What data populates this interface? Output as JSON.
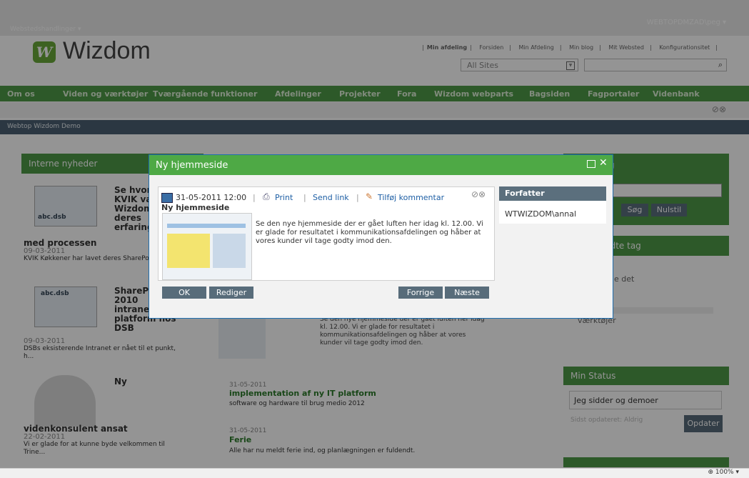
{
  "site_menu": "Webstedshandlinger",
  "user": "WEBTOPDMZAD\\peg",
  "logo": "Wizdom",
  "top_links": [
    "Min afdeling",
    "Forsiden",
    "Min Afdeling",
    "Min blog",
    "Mit Websted",
    "Konfigurationsitet"
  ],
  "scope_select": "All Sites",
  "nav": [
    "Om os",
    "Viden og værktøjer",
    "Tværgående funktioner",
    "Afdelinger",
    "Projekter",
    "Fora",
    "Wizdom webparts",
    "Bagsiden",
    "Fagportaler",
    "Videnbank"
  ],
  "breadcrumb": "Webtop Wizdom Demo",
  "news_panel": {
    "title": "Interne nyheder",
    "items": [
      {
        "thumb": "abc.dsb",
        "title_lines": [
          "Se hvor",
          "KVIK va",
          "Wizdom",
          "deres",
          "erfaring"
        ],
        "title_tail": "med processen",
        "date": "09-03-2011",
        "summary": "KVIK Køkkener har lavet deres SharePoint-intra..."
      },
      {
        "thumb": "abc.dsb",
        "title_lines": [
          "ShareP",
          "2010",
          "intrane",
          "platform hos",
          "DSB"
        ],
        "date": "09-03-2011",
        "summary": "DSBs eksisterende Intranet er nået til et punkt, h..."
      },
      {
        "title_lines": [
          "Ny"
        ],
        "title_tail": "videnkonsulent ansat",
        "date": "22-02-2011",
        "summary": "Vi er glade for at kunne byde velkommen til Trine..."
      }
    ]
  },
  "center_list": [
    {
      "summary_lines": [
        "Se den nye hjemmeside der er gået luften her idag",
        "kl. 12.00. Vi er glade for resultatet i",
        "kommunikationsafdelingen og håber at vores",
        "kunder vil tage godty imod den."
      ]
    },
    {
      "date": "31-05-2011",
      "title": "implementation af ny IT platform",
      "summary": "software og hardware til brug medio 2012"
    },
    {
      "date": "31-05-2011",
      "title": "Ferie",
      "summary": "Alle har nu meldt ferie ind, og planlægningen er fuldendt."
    }
  ],
  "right_panel": {
    "search_title": "g",
    "search_buttons": [
      "Søg",
      "Nulstil"
    ],
    "tags_title": "ndte tag",
    "tags_text": "de det",
    "tools_text": "værktøjer",
    "status_title": "Min Status",
    "status_value": "Jeg sidder og demoer",
    "status_updated": "Sidst opdateret: Aldrig",
    "status_button": "Opdater"
  },
  "modal": {
    "title": "Ny hjemmeside",
    "datetime": "31-05-2011 12:00",
    "actions": [
      "Print",
      "Send link",
      "Tilføj kommentar"
    ],
    "heading": "Ny hjemmeside",
    "body": "Se den nye hjemmeside der er gået luften her idag kl. 12.00. Vi er glade for resultatet i kommunikationsafdelingen og håber at vores kunder vil tage godty imod den.",
    "author_header": "Forfatter",
    "author": "WTWIZDOM\\annal",
    "buttons": {
      "ok": "OK",
      "edit": "Rediger",
      "prev": "Forrige",
      "next": "Næste"
    }
  },
  "statusbar": {
    "zoom": "100%"
  }
}
